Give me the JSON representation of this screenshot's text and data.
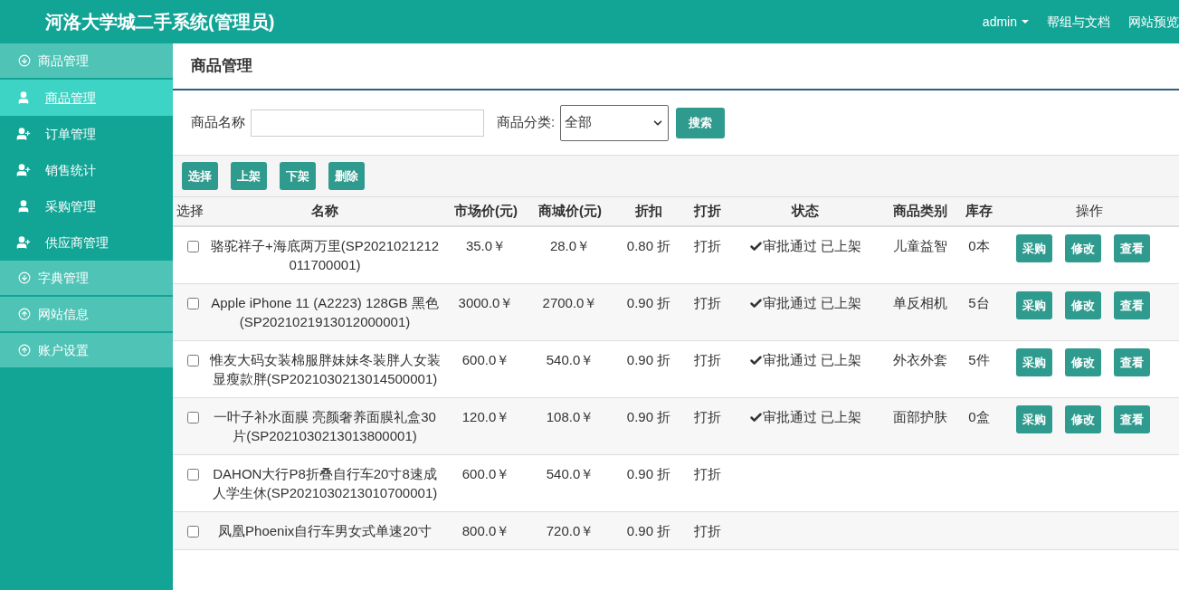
{
  "header": {
    "title": "河洛大学城二手系统(管理员)",
    "user": "admin",
    "links": [
      "帮组与文档",
      "网站预览"
    ]
  },
  "sidebar": [
    {
      "label": "商品管理",
      "expanded": true,
      "children": [
        {
          "label": "商品管理",
          "kind": "user",
          "selected": true
        },
        {
          "label": "订单管理",
          "kind": "user-plus",
          "selected": false
        },
        {
          "label": "销售统计",
          "kind": "user-plus",
          "selected": false
        },
        {
          "label": "采购管理",
          "kind": "user",
          "selected": false
        },
        {
          "label": "供应商管理",
          "kind": "user-plus",
          "selected": false
        }
      ]
    },
    {
      "label": "字典管理",
      "expanded": true
    },
    {
      "label": "网站信息",
      "expanded": false
    },
    {
      "label": "账户设置",
      "expanded": false
    }
  ],
  "page_title": "商品管理",
  "search": {
    "name_label": "商品名称",
    "category_label": "商品分类:",
    "category_value": "全部",
    "button": "搜索"
  },
  "toolbar": [
    "选择",
    "上架",
    "下架",
    "删除"
  ],
  "table": {
    "columns": [
      "选择",
      "名称",
      "市场价(元)",
      "商城价(元)",
      "折扣",
      "打折",
      "状态",
      "商品类别",
      "库存",
      "操作"
    ],
    "rows": [
      {
        "checked": false,
        "name": "骆驼祥子+海底两万里(SP2021021212011700001)",
        "market_price": "35.0￥",
        "mall_price": "28.0￥",
        "discount": "0.80 折",
        "sale": "打折",
        "status": "审批通过 已上架",
        "category": "儿童益智",
        "stock": "0本",
        "actions": [
          "采购",
          "修改",
          "查看"
        ]
      },
      {
        "checked": false,
        "name": "Apple iPhone 11 (A2223) 128GB 黑色(SP2021021913012000001)",
        "market_price": "3000.0￥",
        "mall_price": "2700.0￥",
        "discount": "0.90 折",
        "sale": "打折",
        "status": "审批通过 已上架",
        "category": "单反相机",
        "stock": "5台",
        "actions": [
          "采购",
          "修改",
          "查看"
        ]
      },
      {
        "checked": false,
        "name": "惟友大码女装棉服胖妹妹冬装胖人女装显瘦款胖(SP2021030213014500001)",
        "market_price": "600.0￥",
        "mall_price": "540.0￥",
        "discount": "0.90 折",
        "sale": "打折",
        "status": "审批通过 已上架",
        "category": "外衣外套",
        "stock": "5件",
        "actions": [
          "采购",
          "修改",
          "查看"
        ]
      },
      {
        "checked": false,
        "name": "一叶子补水面膜 亮颜奢养面膜礼盒30片(SP2021030213013800001)",
        "market_price": "120.0￥",
        "mall_price": "108.0￥",
        "discount": "0.90 折",
        "sale": "打折",
        "status": "审批通过 已上架",
        "category": "面部护肤",
        "stock": "0盒",
        "actions": [
          "采购",
          "修改",
          "查看"
        ]
      },
      {
        "checked": false,
        "name": "DAHON大行P8折叠自行车20寸8速成人学生休(SP2021030213010700001)",
        "market_price": "600.0￥",
        "mall_price": "540.0￥",
        "discount": "0.90 折",
        "sale": "打折"
      },
      {
        "checked": false,
        "name": "凤凰Phoenix自行车男女式单速20寸",
        "market_price": "800.0￥",
        "mall_price": "720.0￥",
        "discount": "0.90 折",
        "sale": "打折"
      }
    ]
  }
}
